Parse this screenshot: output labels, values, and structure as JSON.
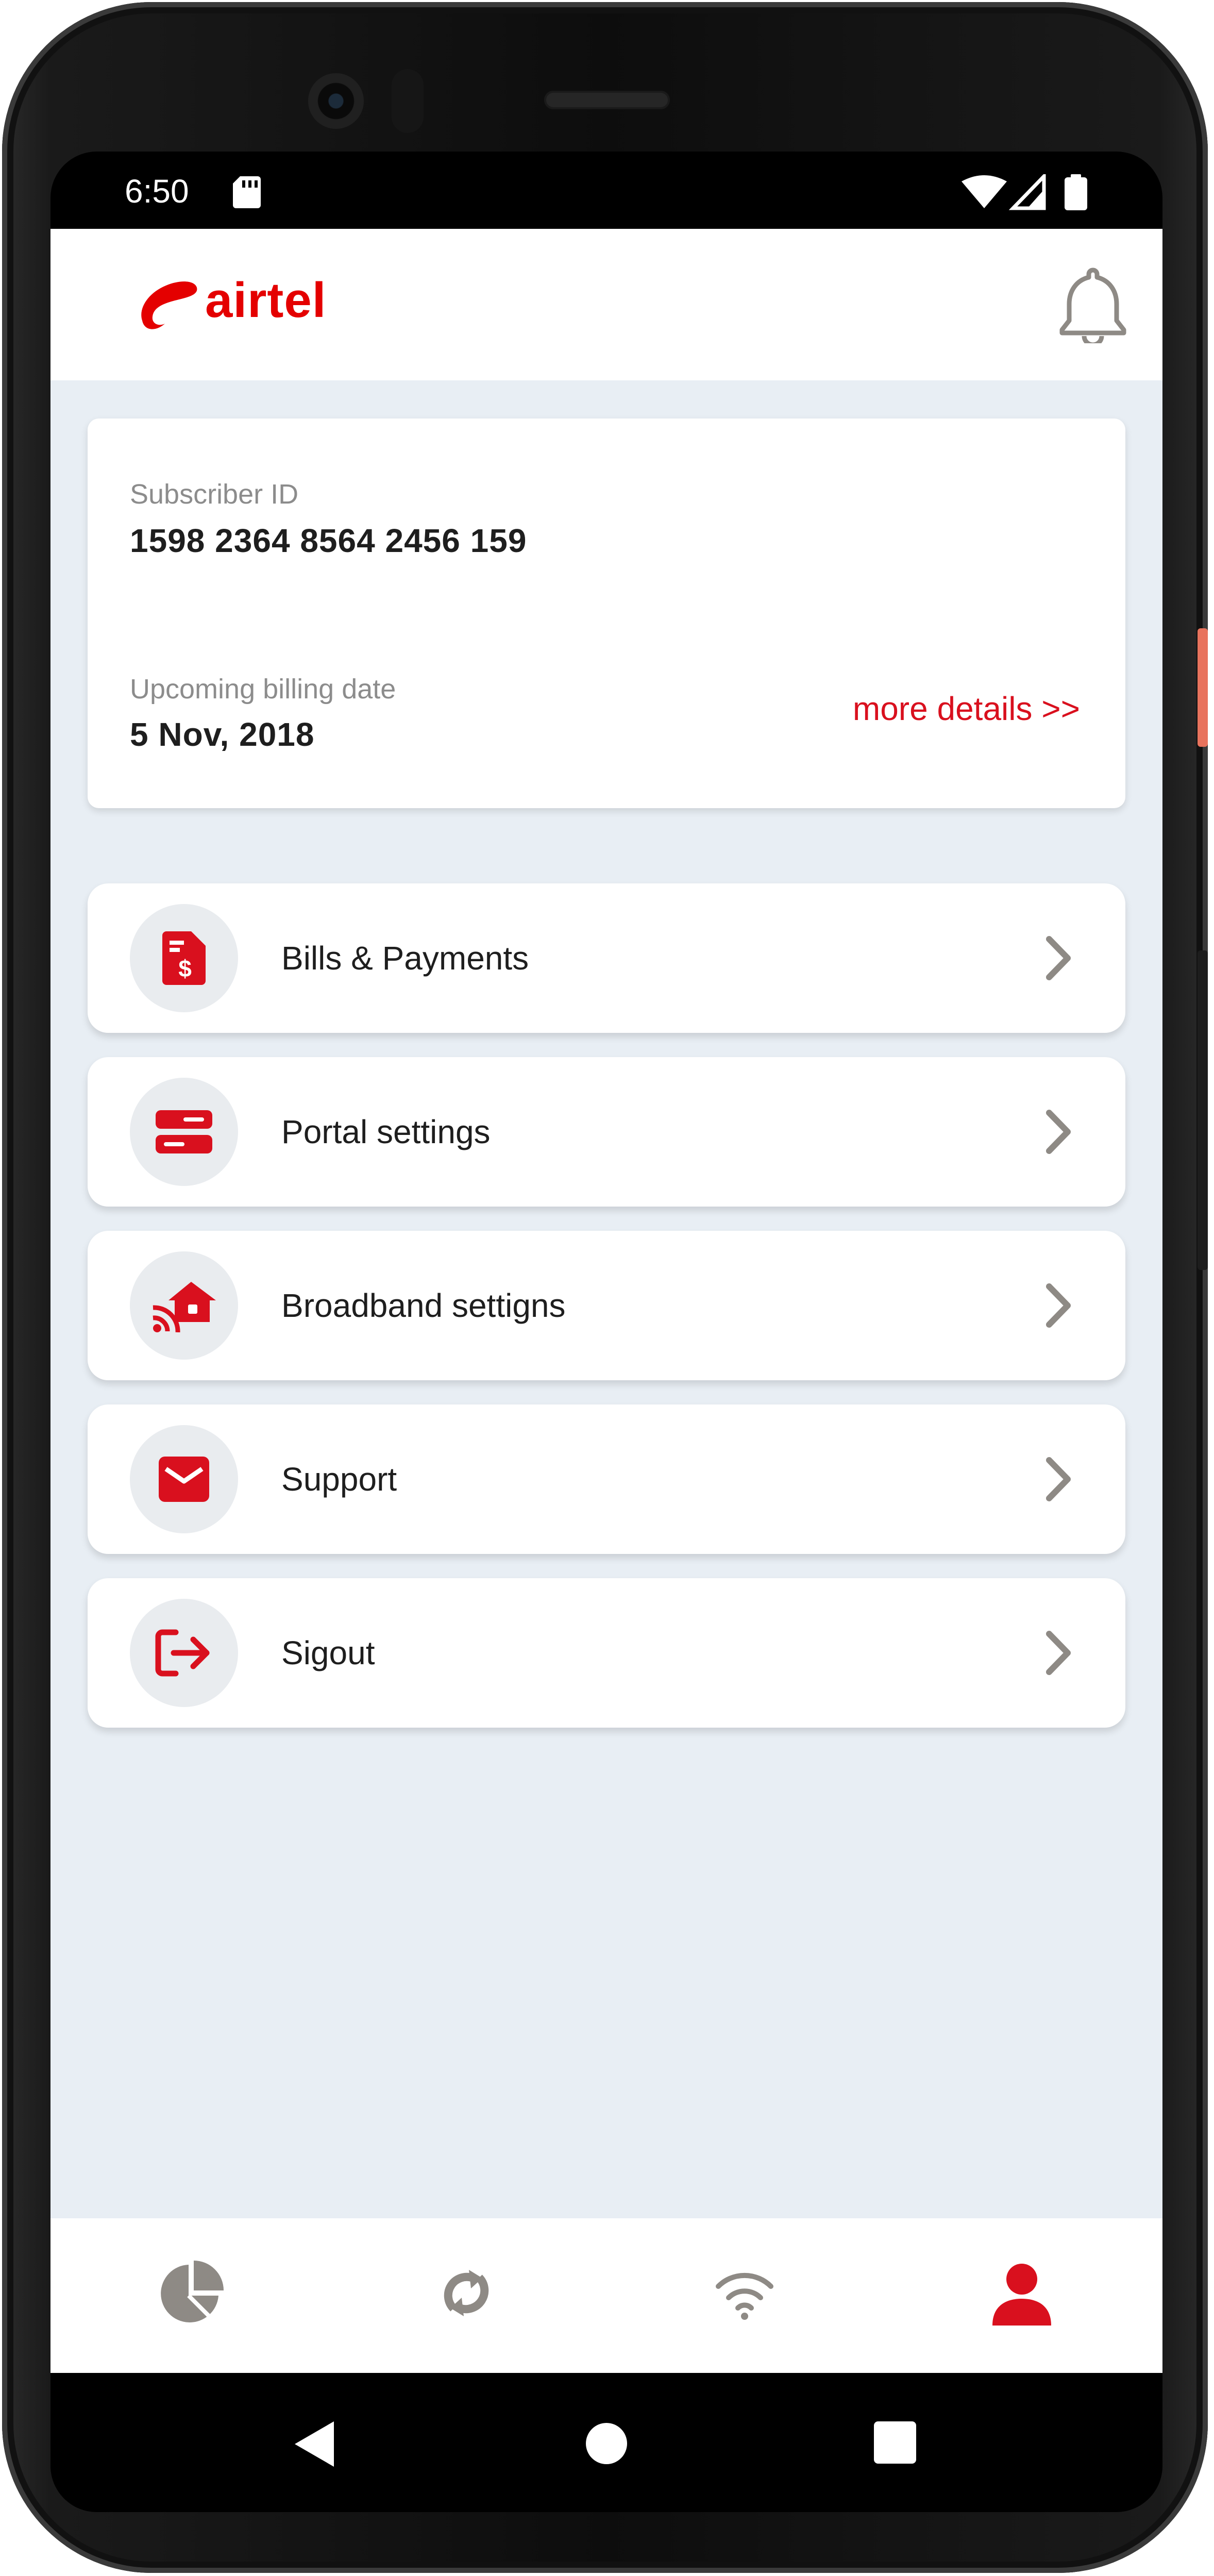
{
  "status_bar": {
    "time": "6:50"
  },
  "header": {
    "brand": "airtel"
  },
  "account": {
    "subscriber_label": "Subscriber ID",
    "subscriber_id": "1598 2364 8564 2456 159",
    "billing_label": "Upcoming billing date",
    "billing_date": "5 Nov, 2018",
    "more_link": "more details >>"
  },
  "menu": [
    {
      "label": "Bills & Payments",
      "icon": "bill-dollar-icon"
    },
    {
      "label": "Portal settings",
      "icon": "server-icon"
    },
    {
      "label": "Broadband settigns",
      "icon": "home-wifi-icon"
    },
    {
      "label": "Support",
      "icon": "mail-icon"
    },
    {
      "label": "Sigout",
      "icon": "logout-icon"
    }
  ],
  "bottom_nav": [
    {
      "icon": "pie-chart-icon",
      "active": false
    },
    {
      "icon": "refresh-icon",
      "active": false
    },
    {
      "icon": "wifi-icon",
      "active": false
    },
    {
      "icon": "user-icon",
      "active": true
    }
  ],
  "colors": {
    "accent": "#d9101e",
    "background": "#e8eef4",
    "inactive": "#8e8a85"
  }
}
